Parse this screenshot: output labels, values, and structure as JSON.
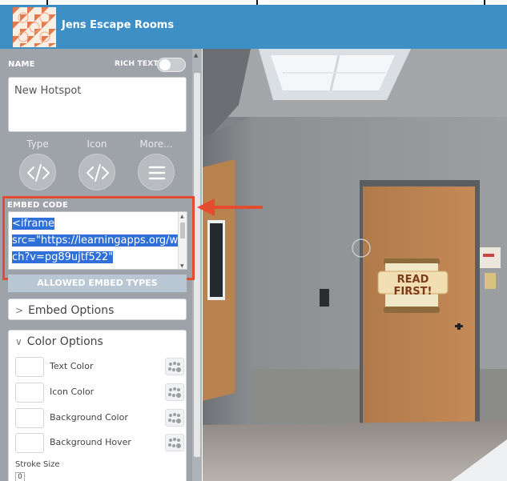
{
  "app": {
    "title": "Jens Escape Rooms"
  },
  "sidebar": {
    "name_label": "NAME",
    "rich_text_label": "RICH TEXT",
    "name_value": "New Hotspot",
    "tools": [
      {
        "label": "Type",
        "icon": "code-icon"
      },
      {
        "label": "Icon",
        "icon": "code-icon"
      },
      {
        "label": "More...",
        "icon": "menu-icon"
      }
    ],
    "embed_label": "EMBED CODE",
    "embed_lines": [
      "<iframe",
      "src=\"https://learningapps.org/wat",
      "ch?v=pg89ujtf522\""
    ],
    "allowed_embed_types": "ALLOWED EMBED TYPES",
    "embed_options": "Embed Options",
    "color_options": "Color Options",
    "color_rows": [
      "Text Color",
      "Icon Color",
      "Background Color",
      "Background Hover"
    ],
    "stroke_size_label": "Stroke Size",
    "stroke_size_value": "0"
  },
  "scene": {
    "hotspot_label": "READ FIRST!"
  },
  "colors": {
    "header": "#3f8fc7",
    "sidebar": "#9da3a8",
    "highlight_frame": "#e54b2f",
    "selection": "#2f6fd8"
  }
}
